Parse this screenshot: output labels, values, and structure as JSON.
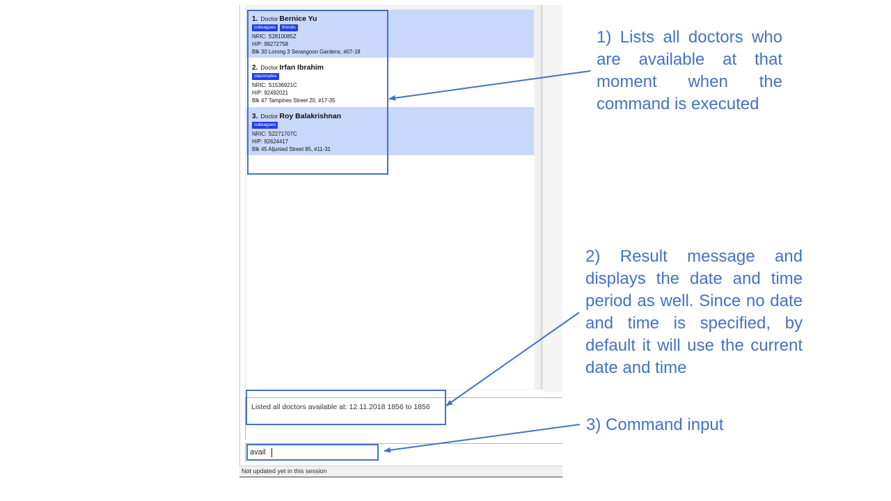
{
  "doctor_list": [
    {
      "index": "1.",
      "role": "Doctor",
      "name": "Bernice Yu",
      "tags": [
        "colleagues",
        "friends"
      ],
      "nric": "NRIC: S2810085Z",
      "phone": "H/P: 99272758",
      "address": "Blk 30 Lorong 3 Serangoon Gardens, #07-18",
      "selected": true
    },
    {
      "index": "2.",
      "role": "Doctor",
      "name": "Irfan Ibrahim",
      "tags": [
        "classmates"
      ],
      "nric": "NRIC: S1536921C",
      "phone": "H/P: 92492021",
      "address": "Blk 47 Tampines Street 20, #17-35",
      "selected": false
    },
    {
      "index": "3.",
      "role": "Doctor",
      "name": "Roy Balakrishnan",
      "tags": [
        "colleagues"
      ],
      "nric": "NRIC: S2271707C",
      "phone": "H/P: 92624417",
      "address": "Blk 45 Aljunied Street 85, #11-31",
      "selected": true
    }
  ],
  "result_display": {
    "text": "Listed all doctors available at: 12.11.2018 1856 to 1856"
  },
  "command_box": {
    "value": "avail"
  },
  "status_bar": {
    "text": "Not updated yet in this session"
  },
  "annotations": {
    "callout_1": "1) Lists all doctors who are available at that moment when the command is executed",
    "callout_2": "2) Result message and displays the date and time period as well. Since no date and time is specified, by default it will use the current date and time",
    "callout_3": "3) Command input"
  },
  "colors": {
    "annotation_blue": "#4472c4",
    "selected_card": "#c9d7fb",
    "tag_background": "#1e40e8"
  }
}
